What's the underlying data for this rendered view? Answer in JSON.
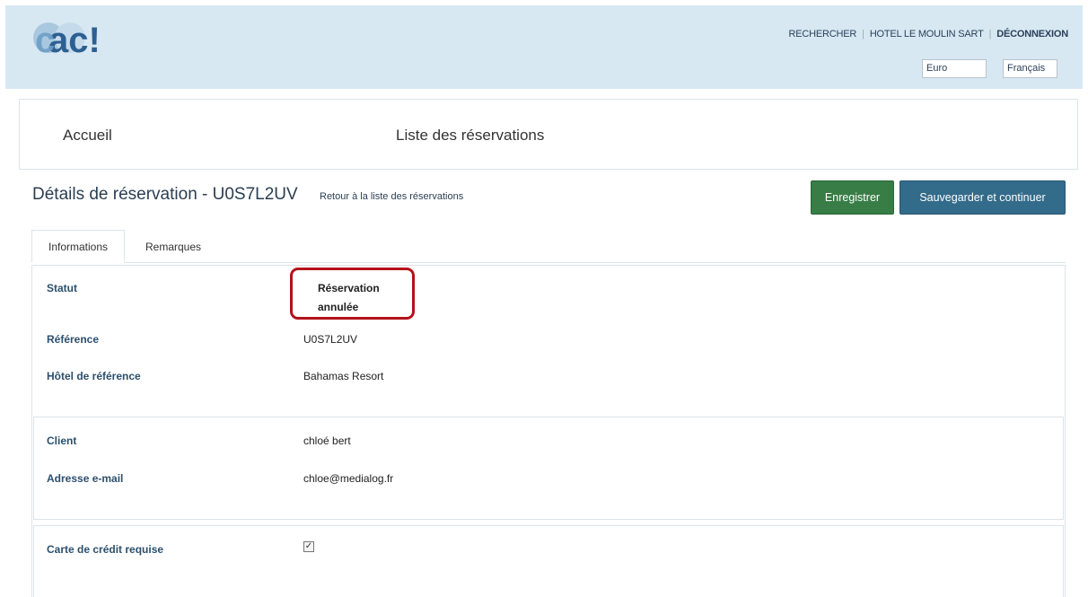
{
  "header": {
    "links": {
      "search": "RECHERCHER",
      "hotel": "HOTEL LE MOULIN SART",
      "logout": "DÉCONNEXION"
    },
    "currency": "Euro",
    "language": "Français"
  },
  "nav": {
    "home": "Accueil",
    "reservations": "Liste des réservations"
  },
  "page": {
    "title": "Détails de réservation - U0S7L2UV",
    "back_link": "Retour à la liste des réservations",
    "save_label": "Enregistrer",
    "save_continue_label": "Sauvegarder et continuer"
  },
  "tabs": {
    "info": "Informations",
    "remarks": "Remarques"
  },
  "details": {
    "status_label": "Statut",
    "status_value": "Réservation annulée",
    "reference_label": "Référence",
    "reference_value": "U0S7L2UV",
    "hotel_label": "Hôtel de référence",
    "hotel_value": "Bahamas Resort",
    "client_label": "Client",
    "client_value": "chloé bert",
    "email_label": "Adresse e-mail",
    "email_value": "chloe@medialog.fr",
    "card_label": "Carte de crédit requise",
    "card_required": true
  },
  "colors": {
    "header_bg": "#d8e8f3",
    "save_button": "#377d45",
    "save_continue_button": "#336b8a",
    "highlight": "#b5111b",
    "label": "#2c4f6c"
  }
}
